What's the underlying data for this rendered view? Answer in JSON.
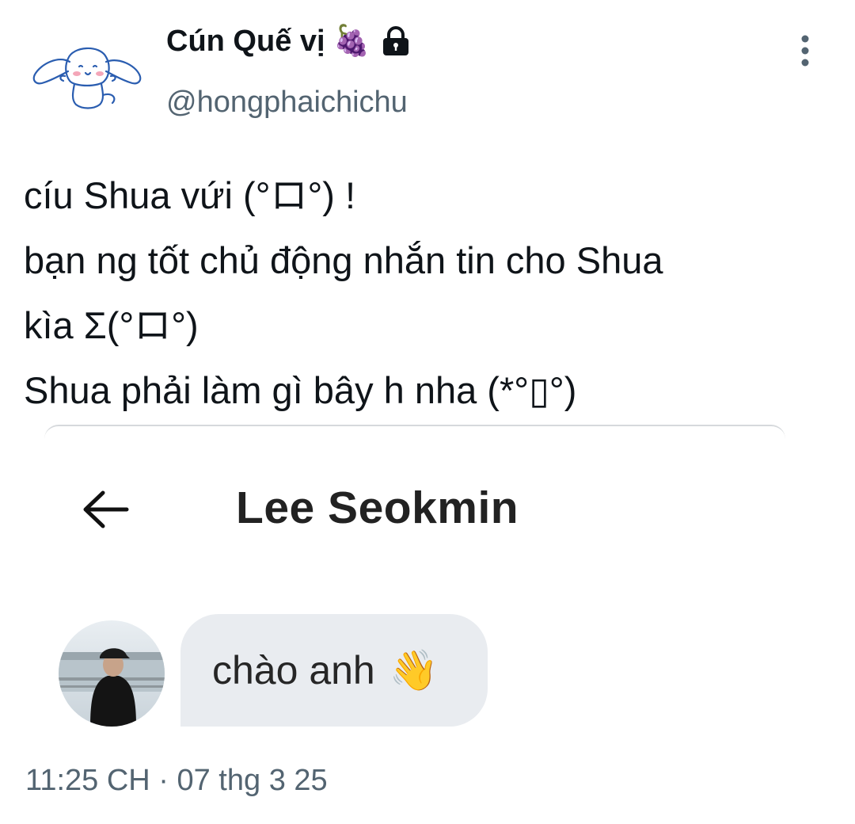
{
  "author": {
    "display_name": "Cún Quế vị",
    "name_emoji": "🍇",
    "lock_icon": "lock-icon",
    "handle": "@hongphaichichu",
    "avatar_icon": "cinnamoroll-avatar"
  },
  "menu": {
    "icon": "more-vertical-icon"
  },
  "tweet": {
    "lines": [
      "cíu Shua vứi (°ロ°) !",
      "bạn ng tốt chủ động nhắn tin cho Shua",
      "kìa Σ(°ロ°)",
      "Shua phải làm gì bây h nha (*°▯°)"
    ]
  },
  "screenshot": {
    "back_icon": "back-arrow-icon",
    "chat_title": "Lee Seokmin",
    "message": {
      "text": "chào anh",
      "emoji": "👋"
    }
  },
  "meta": {
    "timestamp": "11:25 CH · 07 thg 3 25"
  },
  "colors": {
    "text": "#0f1419",
    "secondary": "#536471",
    "bubble": "#e9ecf0"
  }
}
